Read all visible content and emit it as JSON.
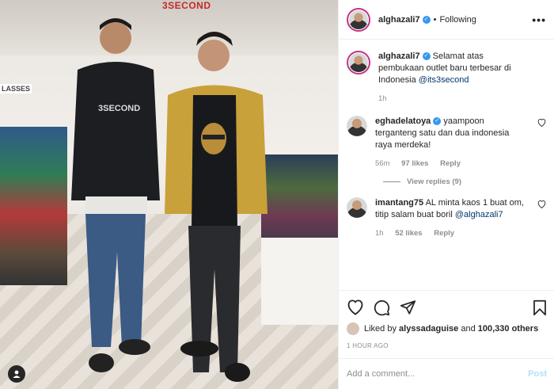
{
  "photo": {
    "store_sign": "3SECOND",
    "glasses_sign": "LASSES",
    "shirt_text": "3SECOND"
  },
  "post": {
    "author": "alghazali7",
    "follow_status": "Following",
    "separator": "•",
    "more": "•••",
    "caption": {
      "username": "alghazali7",
      "text": "Selamat atas pembukaan outlet baru terbesar di Indonesia",
      "mention": "@its3second",
      "time": "1h"
    },
    "comments": [
      {
        "username": "eghadelatoya",
        "text": "yaampoon terganteng satu dan dua indonesia raya merdeka!",
        "time": "56m",
        "likes": "97 likes",
        "reply": "Reply",
        "view_replies": "View replies (9)"
      },
      {
        "username": "imantang75",
        "text": "AL minta kaos 1 buat om, titip salam buat boril",
        "mention": "@alghazali7",
        "time": "1h",
        "likes": "52 likes",
        "reply": "Reply"
      }
    ],
    "liked_by_prefix": "Liked by",
    "liked_by_user": "alyssadaguise",
    "liked_by_and": "and",
    "liked_by_count": "100,330 others",
    "timestamp": "1 HOUR AGO",
    "add_comment_placeholder": "Add a comment...",
    "post_button": "Post"
  },
  "icons": {
    "heart": "heart-icon",
    "comment": "comment-icon",
    "share": "share-icon",
    "save": "bookmark-icon",
    "verified": "verified-icon",
    "user_tag": "user-tag-icon"
  },
  "colors": {
    "link": "#00376b",
    "verified": "#3897f0",
    "muted": "#8e8e8e",
    "post_disabled": "#b2dffc",
    "story_ring": "#c13584"
  }
}
